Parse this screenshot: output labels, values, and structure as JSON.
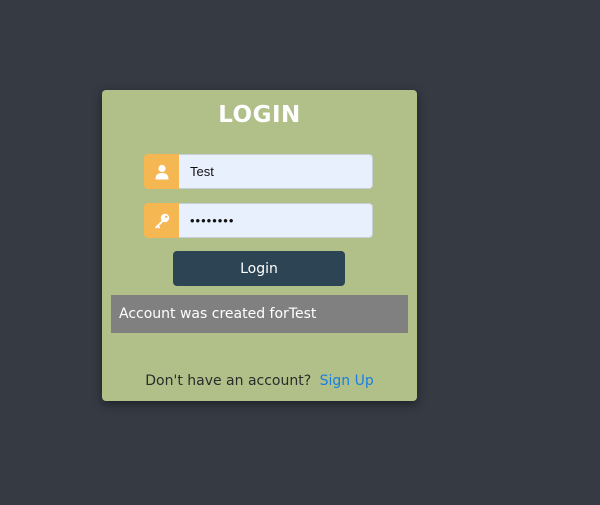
{
  "login_card": {
    "title": "LOGIN",
    "username": {
      "icon": "user-icon",
      "value": "Test"
    },
    "password": {
      "icon": "key-icon",
      "value": "••••••••"
    },
    "login_button_label": "Login",
    "message": "Account was created forTest",
    "footer": {
      "prompt": "Don't have an account?",
      "signup_label": "Sign Up"
    }
  },
  "colors": {
    "background": "#353a43",
    "card": "#b0c088",
    "addon": "#f5b752",
    "button": "#2c4453",
    "message_bg": "#808080",
    "link": "#1a7fe0"
  }
}
